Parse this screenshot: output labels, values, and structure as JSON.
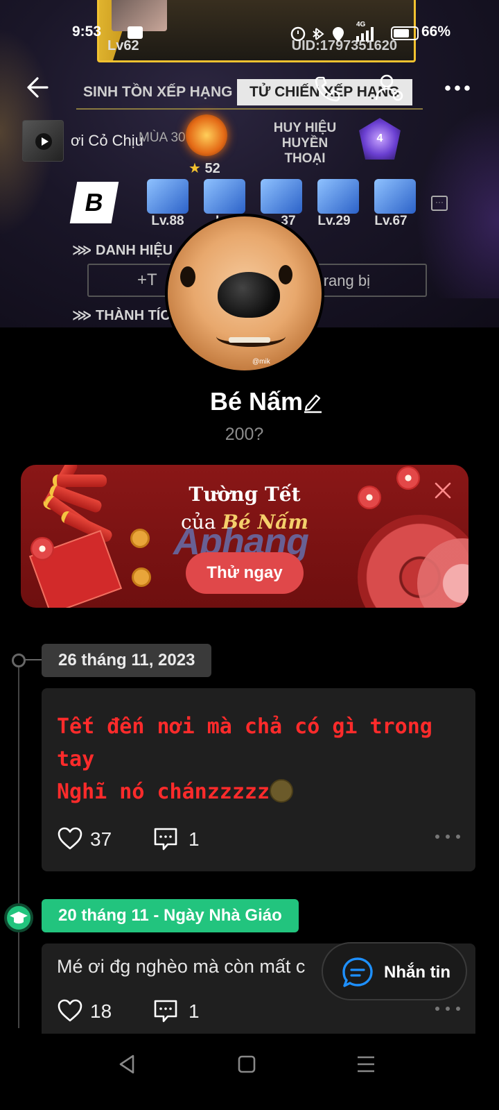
{
  "status_bar": {
    "time": "9:53",
    "battery": "66%",
    "network": "4G"
  },
  "game_card": {
    "level": "Lv62",
    "uid": "UID:1797351620",
    "tabs": [
      "SINH TỒN XẾP HẠNG",
      "TỬ CHIẾN XẾP HẠNG"
    ],
    "music_title": "ơi Cỏ Chịu",
    "season": "MÙA 30",
    "stars": "52",
    "badge_label": "HUY HIỆU HUYỀN THOẠI",
    "badge_level": "4",
    "weapon_levels": [
      "Lv.88",
      "Lv.",
      "37",
      "Lv.29",
      "Lv.67"
    ],
    "section_title": "DANH HIỆU",
    "equip_left": "+T",
    "equip_right": "rang bị",
    "achievements": "THÀNH TÍCH"
  },
  "profile": {
    "name": "Bé Nấm",
    "bio": "200?",
    "avatar_tag": "@mik"
  },
  "banner": {
    "title_line1": "Tường Tết",
    "title_prefix": "của ",
    "title_name": "Bé Nấm",
    "cta": "Thử ngay",
    "watermark": "Aphang"
  },
  "posts": [
    {
      "date": "26 tháng 11, 2023",
      "text": "Tết đến nơi mà chả có gì trong\ntay\nNghĩ nó chánzzzzz",
      "likes": "37",
      "comments": "1"
    },
    {
      "date": "20 tháng 11 - Ngày Nhà Giáo",
      "text": "Mé ơi đg nghèo mà còn mất c",
      "likes": "18",
      "comments": "1"
    }
  ],
  "message_button": "Nhắn tin",
  "colors": {
    "accent_green": "#22c47e",
    "post_red": "#ff2b2b",
    "banner_red": "#8a1717",
    "cta_red": "#e0484a",
    "gold": "#f2c230"
  },
  "icons": [
    "back-arrow-icon",
    "phone-icon",
    "user-settings-icon",
    "more-icon",
    "edit-icon",
    "close-icon",
    "heart-icon",
    "comment-icon",
    "message-icon",
    "graduation-cap-icon",
    "nav-back-icon",
    "nav-home-icon",
    "nav-menu-icon"
  ]
}
